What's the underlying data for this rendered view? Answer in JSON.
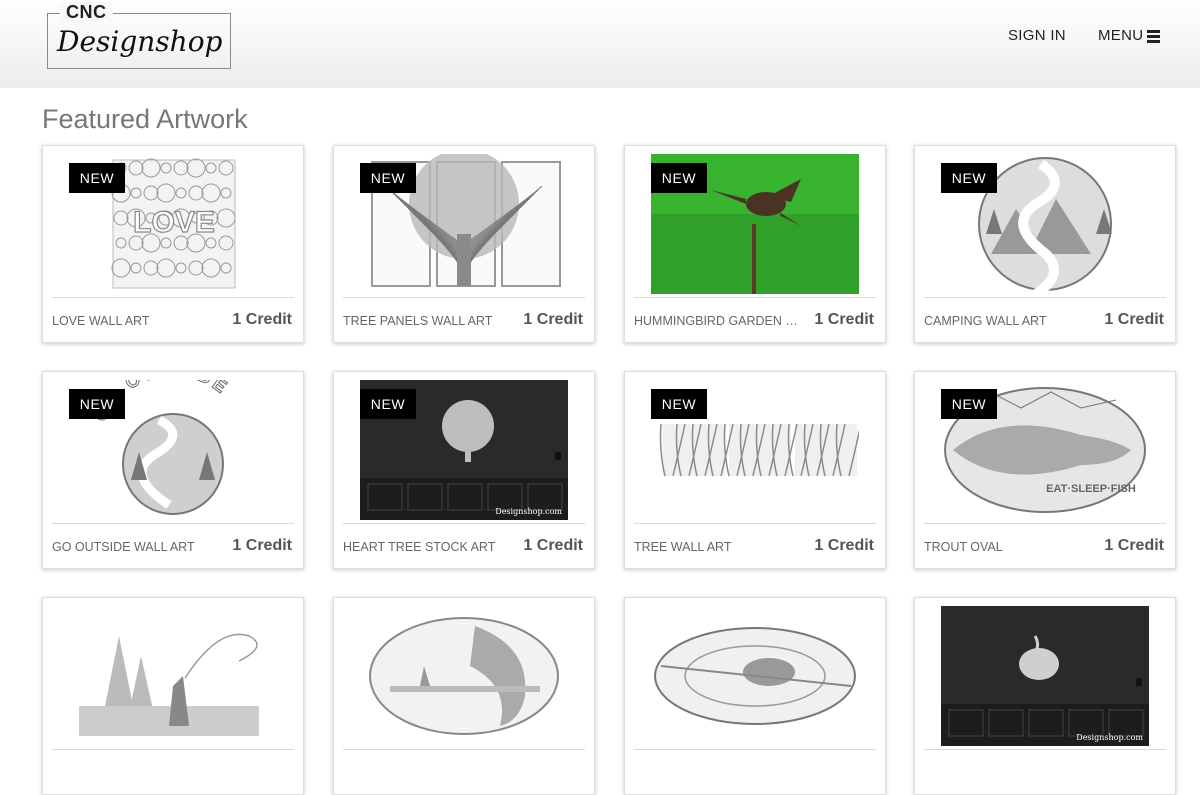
{
  "header": {
    "logo_top": "CNC",
    "logo_script": "Designshop",
    "sign_in": "SIGN IN",
    "menu": "MENU"
  },
  "section_title": "Featured Artwork",
  "products": [
    {
      "name": "LOVE WALL ART",
      "price": "1 Credit",
      "badge": "NEW",
      "art": "love",
      "icon": "love-art-icon"
    },
    {
      "name": "TREE PANELS WALL ART",
      "price": "1 Credit",
      "badge": "NEW",
      "art": "tree-panels",
      "icon": "tree-panels-icon"
    },
    {
      "name": "HUMMINGBIRD GARDEN STA...",
      "price": "1 Credit",
      "badge": "NEW",
      "art": "hummingbird",
      "icon": "hummingbird-icon"
    },
    {
      "name": "CAMPING WALL ART",
      "price": "1 Credit",
      "badge": "NEW",
      "art": "camping",
      "icon": "camping-circle-icon"
    },
    {
      "name": "GO OUTSIDE WALL ART",
      "price": "1 Credit",
      "badge": "NEW",
      "art": "go-outside",
      "icon": "go-outside-icon"
    },
    {
      "name": "HEART TREE STOCK ART",
      "price": "1 Credit",
      "badge": "NEW",
      "art": "heart-tree",
      "icon": "heart-tree-icon"
    },
    {
      "name": "TREE WALL ART",
      "price": "1 Credit",
      "badge": "NEW",
      "art": "tree-wall",
      "icon": "tree-wall-icon"
    },
    {
      "name": "TROUT OVAL",
      "price": "1 Credit",
      "badge": "NEW",
      "art": "trout",
      "icon": "trout-oval-icon"
    },
    {
      "name": "",
      "price": "",
      "badge": "",
      "art": "fly-fisher",
      "icon": "fly-fisher-icon"
    },
    {
      "name": "",
      "price": "",
      "badge": "",
      "art": "bass",
      "icon": "bass-oval-icon"
    },
    {
      "name": "",
      "price": "",
      "badge": "",
      "art": "hat-oval",
      "icon": "hat-oval-icon"
    },
    {
      "name": "",
      "price": "",
      "badge": "",
      "art": "peacock",
      "icon": "peacock-icon"
    }
  ],
  "watermark": "Designshop.com",
  "colors": {
    "badge_bg": "#000000",
    "title": "#777777",
    "grass": "#2fa12b",
    "dark_wall": "#2a2a2a"
  }
}
